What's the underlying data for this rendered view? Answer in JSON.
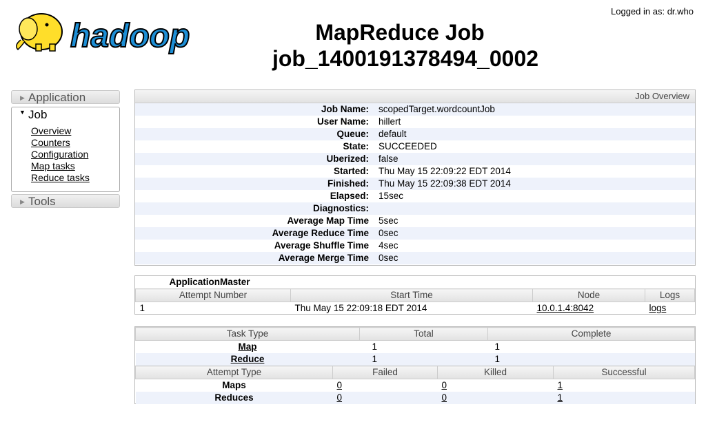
{
  "header": {
    "logged_in": "Logged in as: dr.who",
    "title_line1": "MapReduce Job",
    "title_line2": "job_1400191378494_0002",
    "logo_text": "hadoop"
  },
  "sidebar": {
    "application": "Application",
    "job": "Job",
    "job_links": [
      "Overview",
      "Counters",
      "Configuration",
      "Map tasks",
      "Reduce tasks"
    ],
    "tools": "Tools"
  },
  "overview": {
    "heading": "Job Overview",
    "rows": [
      {
        "k": "Job Name:",
        "v": "scopedTarget.wordcountJob"
      },
      {
        "k": "User Name:",
        "v": "hillert"
      },
      {
        "k": "Queue:",
        "v": "default"
      },
      {
        "k": "State:",
        "v": "SUCCEEDED"
      },
      {
        "k": "Uberized:",
        "v": "false"
      },
      {
        "k": "Started:",
        "v": "Thu May 15 22:09:22 EDT 2014"
      },
      {
        "k": "Finished:",
        "v": "Thu May 15 22:09:38 EDT 2014"
      },
      {
        "k": "Elapsed:",
        "v": "15sec"
      },
      {
        "k": "Diagnostics:",
        "v": ""
      },
      {
        "k": "Average Map Time",
        "v": "5sec"
      },
      {
        "k": "Average Reduce Time",
        "v": "0sec"
      },
      {
        "k": "Average Shuffle Time",
        "v": "4sec"
      },
      {
        "k": "Average Merge Time",
        "v": "0sec"
      }
    ]
  },
  "am": {
    "title": "ApplicationMaster",
    "cols": [
      "Attempt Number",
      "Start Time",
      "Node",
      "Logs"
    ],
    "row": {
      "attempt": "1",
      "start": "Thu May 15 22:09:18 EDT 2014",
      "node": "10.0.1.4:8042",
      "logs": "logs"
    }
  },
  "tasks": {
    "cols": [
      "Task Type",
      "Total",
      "Complete"
    ],
    "rows": [
      {
        "type": "Map",
        "total": "1",
        "complete": "1"
      },
      {
        "type": "Reduce",
        "total": "1",
        "complete": "1"
      }
    ],
    "attempt_cols": [
      "Attempt Type",
      "Failed",
      "Killed",
      "Successful"
    ],
    "attempt_rows": [
      {
        "type": "Maps",
        "failed": "0",
        "killed": "0",
        "successful": "1"
      },
      {
        "type": "Reduces",
        "failed": "0",
        "killed": "0",
        "successful": "1"
      }
    ]
  }
}
